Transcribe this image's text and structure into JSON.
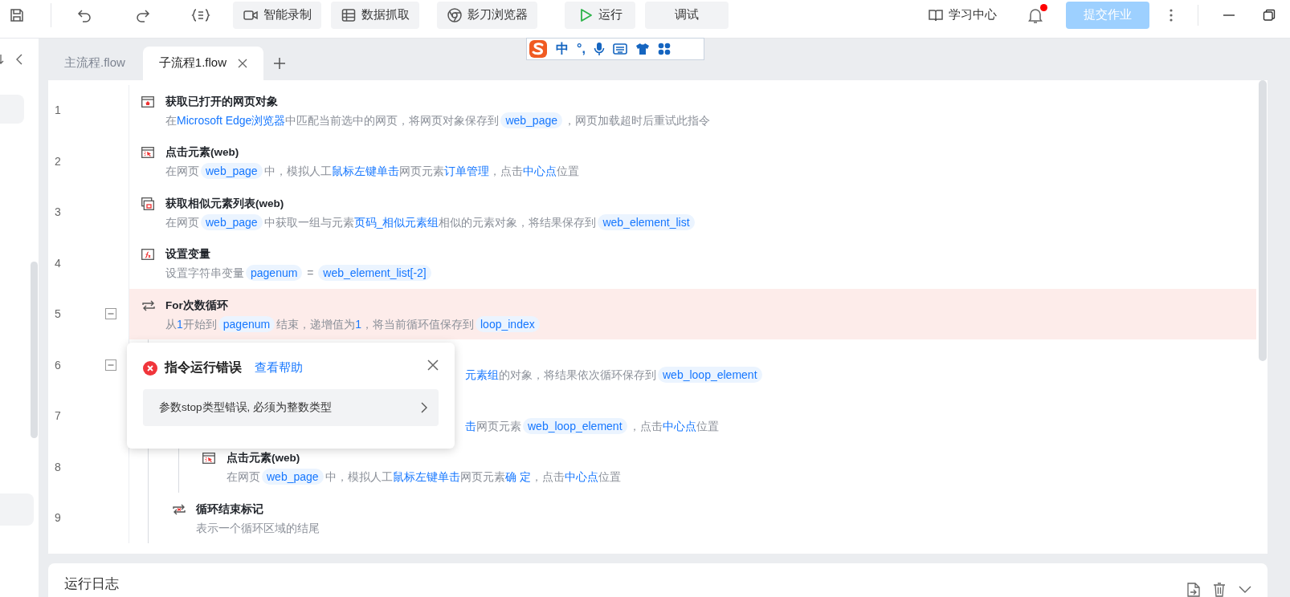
{
  "toolbar": {
    "buttons": [
      {
        "label": "智能录制",
        "kind": "record"
      },
      {
        "label": "数据抓取",
        "kind": "table"
      },
      {
        "label": "影刀浏览器",
        "kind": "browser"
      },
      {
        "label": "运行",
        "kind": "run"
      },
      {
        "label": "调试",
        "kind": "plain"
      }
    ],
    "learn": "学习中心",
    "notification_unread": true,
    "submit": {
      "label": "提交作业",
      "disabled": true
    }
  },
  "ime_toolbar": {
    "items": [
      "中",
      "°,"
    ]
  },
  "tabs": [
    {
      "label": "主流程.flow",
      "selected": false
    },
    {
      "label": "子流程1.flow",
      "selected": true
    }
  ],
  "steps": [
    {
      "line": "1",
      "kind": "web-page",
      "error": false,
      "covered": false,
      "title": "获取已打开的网页对象",
      "desc": [
        {
          "kind": "text",
          "text": "在"
        },
        {
          "kind": "link",
          "text": "Microsoft Edge浏览器"
        },
        {
          "kind": "text",
          "text": "中匹配当前选中的网页，将网页对象保存到"
        },
        {
          "kind": "var",
          "text": "web_page"
        },
        {
          "kind": "text",
          "text": "，网页加载超时后重试此指令"
        }
      ]
    },
    {
      "line": "2",
      "kind": "click",
      "error": false,
      "covered": false,
      "title": "点击元素(web)",
      "desc": [
        {
          "kind": "text",
          "text": "在网页"
        },
        {
          "kind": "var",
          "text": "web_page"
        },
        {
          "kind": "text",
          "text": "中，模拟人工"
        },
        {
          "kind": "link",
          "text": "鼠标左键单击"
        },
        {
          "kind": "text",
          "text": "网页元素"
        },
        {
          "kind": "link",
          "text": "订单管理"
        },
        {
          "kind": "text",
          "text": "，点击"
        },
        {
          "kind": "link",
          "text": "中心点"
        },
        {
          "kind": "text",
          "text": "位置"
        }
      ]
    },
    {
      "line": "3",
      "kind": "list",
      "error": false,
      "covered": false,
      "title": "获取相似元素列表(web)",
      "desc": [
        {
          "kind": "text",
          "text": "在网页"
        },
        {
          "kind": "var",
          "text": "web_page"
        },
        {
          "kind": "text",
          "text": "中获取一组与元素"
        },
        {
          "kind": "link",
          "text": "页码_相似元素组"
        },
        {
          "kind": "text",
          "text": "相似的元素对象，将结果保存到"
        },
        {
          "kind": "var",
          "text": "web_element_list"
        }
      ]
    },
    {
      "line": "4",
      "kind": "variable",
      "error": false,
      "covered": false,
      "title": "设置变量",
      "desc": [
        {
          "kind": "text",
          "text": "设置字符串变量"
        },
        {
          "kind": "var",
          "text": "pagenum"
        },
        {
          "kind": "text",
          "text": " = "
        },
        {
          "kind": "var",
          "text": "web_element_list[-2]"
        }
      ]
    },
    {
      "line": "5",
      "kind": "loop",
      "error": true,
      "covered": false,
      "expanded": true,
      "title": "For次数循环",
      "desc": [
        {
          "kind": "text",
          "text": "从"
        },
        {
          "kind": "link",
          "text": "1"
        },
        {
          "kind": "text",
          "text": "开始到"
        },
        {
          "kind": "var",
          "text": "pagenum"
        },
        {
          "kind": "text",
          "text": "结束，递增值为"
        },
        {
          "kind": "link",
          "text": "1"
        },
        {
          "kind": "text",
          "text": "，将当前循环值保存到"
        },
        {
          "kind": "var",
          "text": "loop_index"
        }
      ],
      "children": [
        {
          "line": "6",
          "error": false,
          "covered": true,
          "expanded": true,
          "desc": [
            {
              "kind": "link",
              "text": "元素组"
            },
            {
              "kind": "text",
              "text": "的对象，将结果依次循环保存到"
            },
            {
              "kind": "var",
              "text": "web_loop_element"
            }
          ],
          "children": [
            {
              "line": "7",
              "error": false,
              "covered": true,
              "desc": [
                {
                  "kind": "link",
                  "text": "击"
                },
                {
                  "kind": "text",
                  "text": "网页元素"
                },
                {
                  "kind": "var",
                  "text": "web_loop_element"
                },
                {
                  "kind": "text",
                  "text": "，点击"
                },
                {
                  "kind": "link",
                  "text": "中心点"
                },
                {
                  "kind": "text",
                  "text": "位置"
                }
              ]
            },
            {
              "line": "8",
              "kind": "click",
              "error": false,
              "covered": false,
              "title": "点击元素(web)",
              "desc": [
                {
                  "kind": "text",
                  "text": "在网页"
                },
                {
                  "kind": "var",
                  "text": "web_page"
                },
                {
                  "kind": "text",
                  "text": "中，模拟人工"
                },
                {
                  "kind": "link",
                  "text": "鼠标左键单击"
                },
                {
                  "kind": "text",
                  "text": "网页元素"
                },
                {
                  "kind": "link",
                  "text": "确 定"
                },
                {
                  "kind": "text",
                  "text": "，点击"
                },
                {
                  "kind": "link",
                  "text": "中心点"
                },
                {
                  "kind": "text",
                  "text": "位置"
                }
              ]
            }
          ]
        },
        {
          "line": "9",
          "kind": "loop-end",
          "error": false,
          "covered": false,
          "title": "循环结束标记",
          "desc": [
            {
              "kind": "text",
              "text": "表示一个循环区域的结尾"
            }
          ]
        }
      ]
    }
  ],
  "error_popup": {
    "title": "指令运行错误",
    "help_link": "查看帮助",
    "message": "参数stop类型错误, 必须为整数类型"
  },
  "log_panel": {
    "title": "运行日志"
  }
}
